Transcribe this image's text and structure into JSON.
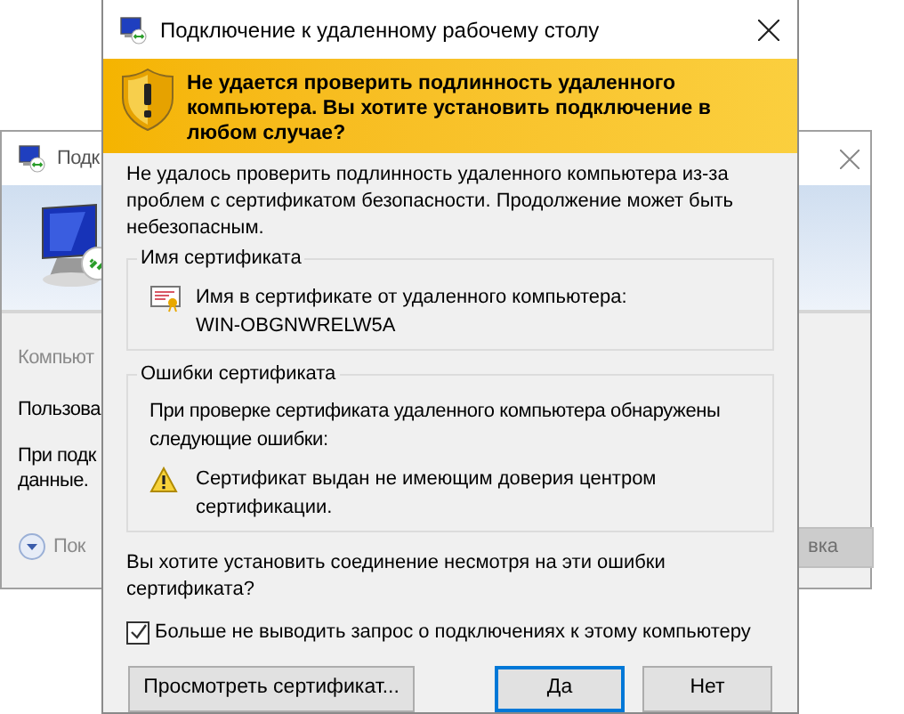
{
  "background_window": {
    "title": "Подк",
    "labels": [
      {
        "text": "Компьют",
        "kind": "muted"
      },
      {
        "text": "Пользова",
        "kind": "normal"
      },
      {
        "text": "При подк",
        "kind": "normal"
      },
      {
        "text": "данные.",
        "kind": "normal"
      }
    ],
    "options_link": "Пок",
    "button": {
      "label": "вка",
      "disabled": true
    }
  },
  "dialog": {
    "title": "Подключение к удаленному рабочему столу",
    "banner": "Не удается проверить подлинность удаленного компьютера. Вы хотите установить подключение в любом случае?",
    "intro": "Не удалось проверить подлинность удаленного компьютера из-за проблем с сертификатом безопасности. Продолжение может быть небезопасным.",
    "groups": [
      {
        "title": "Имя сертификата",
        "kind": "name",
        "lines": [
          "Имя в сертификате от удаленного компьютера:",
          "WIN-OBGNWRELW5A"
        ]
      },
      {
        "title": "Ошибки сертификата",
        "kind": "errors",
        "intro": "При проверке сертификата удаленного компьютера обнаружены следующие ошибки:",
        "errors": [
          "Сертификат выдан не имеющим доверия центром сертификации."
        ]
      }
    ],
    "question": "Вы хотите установить соединение несмотря на эти ошибки сертификата?",
    "checkbox": {
      "label": "Больше не выводить запрос о подключениях к этому компьютеру",
      "checked": true
    },
    "buttons": [
      {
        "label": "Просмотреть сертификат...",
        "focused": false
      },
      {
        "label": "Да",
        "focused": true
      },
      {
        "label": "Нет",
        "focused": false
      }
    ]
  }
}
